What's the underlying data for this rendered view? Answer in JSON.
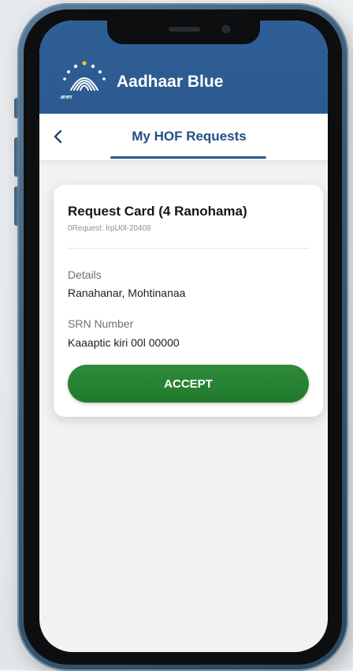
{
  "app": {
    "title": "Aadhaar Blue",
    "logo_text": "आधार"
  },
  "nav": {
    "back_icon": "chevron-left-icon",
    "tab_title": "My HOF Requests"
  },
  "request_card": {
    "title": "Request Card (4 Ranohama)",
    "request_id": "0Request: lrpU0l-20408",
    "details_label": "Details",
    "details_value": "Ranahanar, Mohtinanaa",
    "srn_label": "SRN Number",
    "srn_value": "Kaaaptic kiri 00l 00000",
    "accept_label": "ACCEPT"
  },
  "colors": {
    "header_blue": "#2f5f97",
    "tab_text": "#234f86",
    "accept_green": "#2e8b3a"
  }
}
